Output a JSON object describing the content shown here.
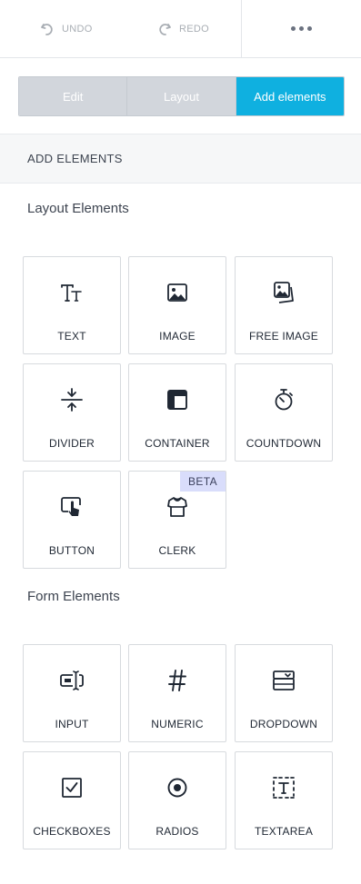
{
  "toolbar": {
    "undo_label": "UNDO",
    "redo_label": "REDO",
    "disabled_color": "#a9aeb4"
  },
  "tabs": [
    {
      "label": "Edit",
      "active": false
    },
    {
      "label": "Layout",
      "active": false
    },
    {
      "label": "Add elements",
      "active": true
    }
  ],
  "accent_color": "#0fb0e0",
  "section_title": "ADD ELEMENTS",
  "layout_group": {
    "title": "Layout Elements",
    "items": [
      {
        "label": "TEXT",
        "icon": "text-icon"
      },
      {
        "label": "IMAGE",
        "icon": "image-icon"
      },
      {
        "label": "FREE IMAGE",
        "icon": "free-image-icon"
      },
      {
        "label": "DIVIDER",
        "icon": "divider-icon"
      },
      {
        "label": "CONTAINER",
        "icon": "container-icon"
      },
      {
        "label": "COUNTDOWN",
        "icon": "stopwatch-icon"
      },
      {
        "label": "BUTTON",
        "icon": "button-click-icon"
      },
      {
        "label": "CLERK",
        "icon": "shirt-icon",
        "badge": "BETA"
      }
    ]
  },
  "form_group": {
    "title": "Form Elements",
    "items": [
      {
        "label": "INPUT",
        "icon": "input-field-icon"
      },
      {
        "label": "NUMERIC",
        "icon": "hash-icon"
      },
      {
        "label": "DROPDOWN",
        "icon": "dropdown-icon"
      },
      {
        "label": "CHECKBOXES",
        "icon": "checkbox-icon"
      },
      {
        "label": "RADIOS",
        "icon": "radio-icon"
      },
      {
        "label": "TEXTAREA",
        "icon": "textarea-icon"
      }
    ]
  }
}
